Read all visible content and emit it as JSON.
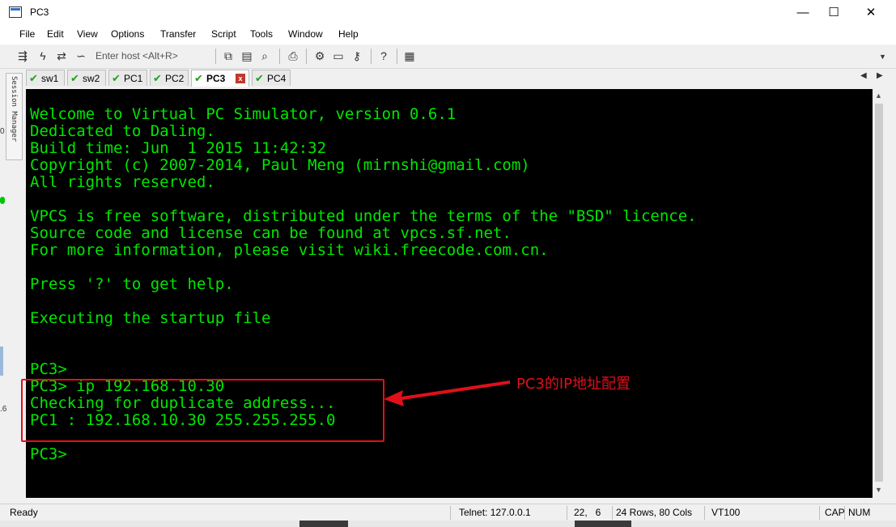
{
  "window": {
    "title": "PC3",
    "minimize": "—",
    "maximize": "☐",
    "close": "✕"
  },
  "menu": [
    "File",
    "Edit",
    "View",
    "Options",
    "Transfer",
    "Script",
    "Tools",
    "Window",
    "Help"
  ],
  "toolbar": {
    "host_placeholder": "Enter host <Alt+R>"
  },
  "session_manager": {
    "label": "Session Manager"
  },
  "tabs": [
    {
      "label": "sw1",
      "active": false
    },
    {
      "label": "sw2",
      "active": false
    },
    {
      "label": "PC1",
      "active": false
    },
    {
      "label": "PC2",
      "active": false
    },
    {
      "label": "PC3",
      "active": true
    },
    {
      "label": "PC4",
      "active": false
    }
  ],
  "terminal": {
    "lines": [
      "Welcome to Virtual PC Simulator, version 0.6.1",
      "Dedicated to Daling.",
      "Build time: Jun  1 2015 11:42:32",
      "Copyright (c) 2007-2014, Paul Meng (mirnshi@gmail.com)",
      "All rights reserved.",
      "",
      "VPCS is free software, distributed under the terms of the \"BSD\" licence.",
      "Source code and license can be found at vpcs.sf.net.",
      "For more information, please visit wiki.freecode.com.cn.",
      "",
      "Press '?' to get help.",
      "",
      "Executing the startup file",
      "",
      "",
      "PC3>",
      "PC3> ip 192.168.10.30",
      "Checking for duplicate address...",
      "PC1 : 192.168.10.30 255.255.255.0",
      "",
      "PC3>"
    ],
    "text_color": "#00e600",
    "background": "#000000"
  },
  "annotation": {
    "text": "PC3的IP地址配置",
    "color": "#e0101a"
  },
  "status": {
    "ready": "Ready",
    "connection": "Telnet: 127.0.0.1",
    "cursor": "22,   6",
    "size": "24 Rows, 80 Cols",
    "emulation": "VT100",
    "caps": "CAP",
    "num": "NUM"
  }
}
